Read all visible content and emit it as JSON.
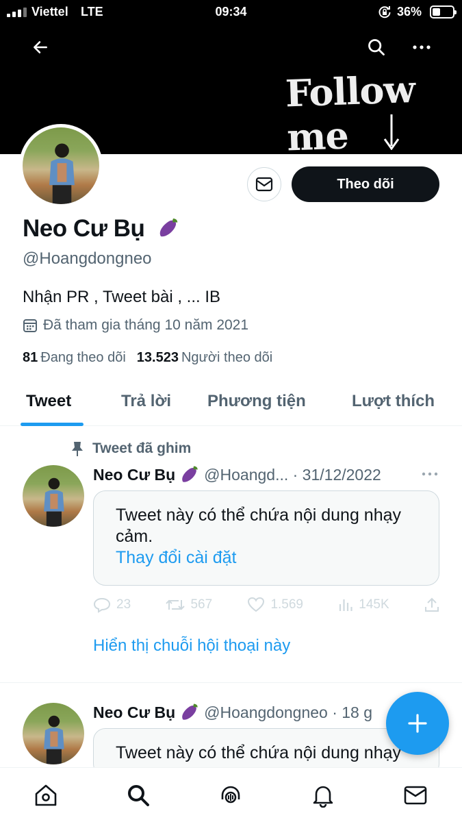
{
  "status_bar": {
    "carrier": "Viettel",
    "network": "LTE",
    "time": "09:34",
    "battery": "36%"
  },
  "banner": {
    "text": "Follow me"
  },
  "profile": {
    "display_name": "Neo Cư Bụ",
    "handle": "@Hoangdongneo",
    "bio": "Nhận PR , Tweet bài , ... IB",
    "joined": "Đã tham gia tháng 10 năm 2021",
    "following_count": "81",
    "following_label": "Đang theo dõi",
    "followers_count": "13.523",
    "followers_label": "Người theo dõi",
    "follow_button": "Theo dõi"
  },
  "tabs": [
    {
      "label": "Tweet",
      "active": true
    },
    {
      "label": "Trả lời",
      "active": false
    },
    {
      "label": "Phương tiện",
      "active": false
    },
    {
      "label": "Lượt thích",
      "active": false
    }
  ],
  "tweets": [
    {
      "pinned_label": "Tweet đã ghim",
      "name": "Neo Cư Bụ",
      "meta": "@Hoangd... · 31/12/2022",
      "sensitive_text": "Tweet này có thể chứa nội dung nhạy cảm.",
      "change_settings": "Thay đổi cài đặt",
      "replies": "23",
      "retweets": "567",
      "likes": "1.569",
      "views": "145K",
      "show_thread": "Hiển thị chuỗi hội thoại này"
    },
    {
      "name": "Neo Cư Bụ",
      "meta": "@Hoangdongneo · 18 g",
      "sensitive_text": "Tweet này có thể chứa nội dung nhạy"
    }
  ],
  "icons": {
    "accent": "#1d9bf0",
    "nav": [
      "home-icon",
      "search-icon",
      "spaces-icon",
      "bell-icon",
      "mail-icon"
    ]
  }
}
